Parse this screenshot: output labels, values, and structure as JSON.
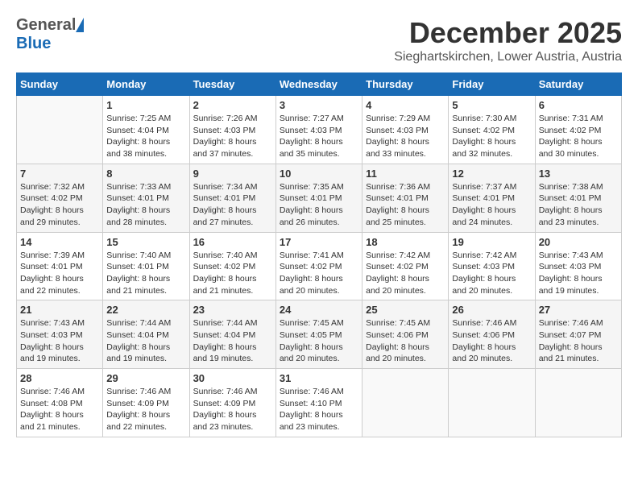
{
  "header": {
    "logo_general": "General",
    "logo_blue": "Blue",
    "month_year": "December 2025",
    "location": "Sieghartskirchen, Lower Austria, Austria"
  },
  "weekdays": [
    "Sunday",
    "Monday",
    "Tuesday",
    "Wednesday",
    "Thursday",
    "Friday",
    "Saturday"
  ],
  "weeks": [
    [
      {
        "day": "",
        "content": ""
      },
      {
        "day": "1",
        "content": "Sunrise: 7:25 AM\nSunset: 4:04 PM\nDaylight: 8 hours\nand 38 minutes."
      },
      {
        "day": "2",
        "content": "Sunrise: 7:26 AM\nSunset: 4:03 PM\nDaylight: 8 hours\nand 37 minutes."
      },
      {
        "day": "3",
        "content": "Sunrise: 7:27 AM\nSunset: 4:03 PM\nDaylight: 8 hours\nand 35 minutes."
      },
      {
        "day": "4",
        "content": "Sunrise: 7:29 AM\nSunset: 4:03 PM\nDaylight: 8 hours\nand 33 minutes."
      },
      {
        "day": "5",
        "content": "Sunrise: 7:30 AM\nSunset: 4:02 PM\nDaylight: 8 hours\nand 32 minutes."
      },
      {
        "day": "6",
        "content": "Sunrise: 7:31 AM\nSunset: 4:02 PM\nDaylight: 8 hours\nand 30 minutes."
      }
    ],
    [
      {
        "day": "7",
        "content": "Sunrise: 7:32 AM\nSunset: 4:02 PM\nDaylight: 8 hours\nand 29 minutes."
      },
      {
        "day": "8",
        "content": "Sunrise: 7:33 AM\nSunset: 4:01 PM\nDaylight: 8 hours\nand 28 minutes."
      },
      {
        "day": "9",
        "content": "Sunrise: 7:34 AM\nSunset: 4:01 PM\nDaylight: 8 hours\nand 27 minutes."
      },
      {
        "day": "10",
        "content": "Sunrise: 7:35 AM\nSunset: 4:01 PM\nDaylight: 8 hours\nand 26 minutes."
      },
      {
        "day": "11",
        "content": "Sunrise: 7:36 AM\nSunset: 4:01 PM\nDaylight: 8 hours\nand 25 minutes."
      },
      {
        "day": "12",
        "content": "Sunrise: 7:37 AM\nSunset: 4:01 PM\nDaylight: 8 hours\nand 24 minutes."
      },
      {
        "day": "13",
        "content": "Sunrise: 7:38 AM\nSunset: 4:01 PM\nDaylight: 8 hours\nand 23 minutes."
      }
    ],
    [
      {
        "day": "14",
        "content": "Sunrise: 7:39 AM\nSunset: 4:01 PM\nDaylight: 8 hours\nand 22 minutes."
      },
      {
        "day": "15",
        "content": "Sunrise: 7:40 AM\nSunset: 4:01 PM\nDaylight: 8 hours\nand 21 minutes."
      },
      {
        "day": "16",
        "content": "Sunrise: 7:40 AM\nSunset: 4:02 PM\nDaylight: 8 hours\nand 21 minutes."
      },
      {
        "day": "17",
        "content": "Sunrise: 7:41 AM\nSunset: 4:02 PM\nDaylight: 8 hours\nand 20 minutes."
      },
      {
        "day": "18",
        "content": "Sunrise: 7:42 AM\nSunset: 4:02 PM\nDaylight: 8 hours\nand 20 minutes."
      },
      {
        "day": "19",
        "content": "Sunrise: 7:42 AM\nSunset: 4:03 PM\nDaylight: 8 hours\nand 20 minutes."
      },
      {
        "day": "20",
        "content": "Sunrise: 7:43 AM\nSunset: 4:03 PM\nDaylight: 8 hours\nand 19 minutes."
      }
    ],
    [
      {
        "day": "21",
        "content": "Sunrise: 7:43 AM\nSunset: 4:03 PM\nDaylight: 8 hours\nand 19 minutes."
      },
      {
        "day": "22",
        "content": "Sunrise: 7:44 AM\nSunset: 4:04 PM\nDaylight: 8 hours\nand 19 minutes."
      },
      {
        "day": "23",
        "content": "Sunrise: 7:44 AM\nSunset: 4:04 PM\nDaylight: 8 hours\nand 19 minutes."
      },
      {
        "day": "24",
        "content": "Sunrise: 7:45 AM\nSunset: 4:05 PM\nDaylight: 8 hours\nand 20 minutes."
      },
      {
        "day": "25",
        "content": "Sunrise: 7:45 AM\nSunset: 4:06 PM\nDaylight: 8 hours\nand 20 minutes."
      },
      {
        "day": "26",
        "content": "Sunrise: 7:46 AM\nSunset: 4:06 PM\nDaylight: 8 hours\nand 20 minutes."
      },
      {
        "day": "27",
        "content": "Sunrise: 7:46 AM\nSunset: 4:07 PM\nDaylight: 8 hours\nand 21 minutes."
      }
    ],
    [
      {
        "day": "28",
        "content": "Sunrise: 7:46 AM\nSunset: 4:08 PM\nDaylight: 8 hours\nand 21 minutes."
      },
      {
        "day": "29",
        "content": "Sunrise: 7:46 AM\nSunset: 4:09 PM\nDaylight: 8 hours\nand 22 minutes."
      },
      {
        "day": "30",
        "content": "Sunrise: 7:46 AM\nSunset: 4:09 PM\nDaylight: 8 hours\nand 23 minutes."
      },
      {
        "day": "31",
        "content": "Sunrise: 7:46 AM\nSunset: 4:10 PM\nDaylight: 8 hours\nand 23 minutes."
      },
      {
        "day": "",
        "content": ""
      },
      {
        "day": "",
        "content": ""
      },
      {
        "day": "",
        "content": ""
      }
    ]
  ]
}
